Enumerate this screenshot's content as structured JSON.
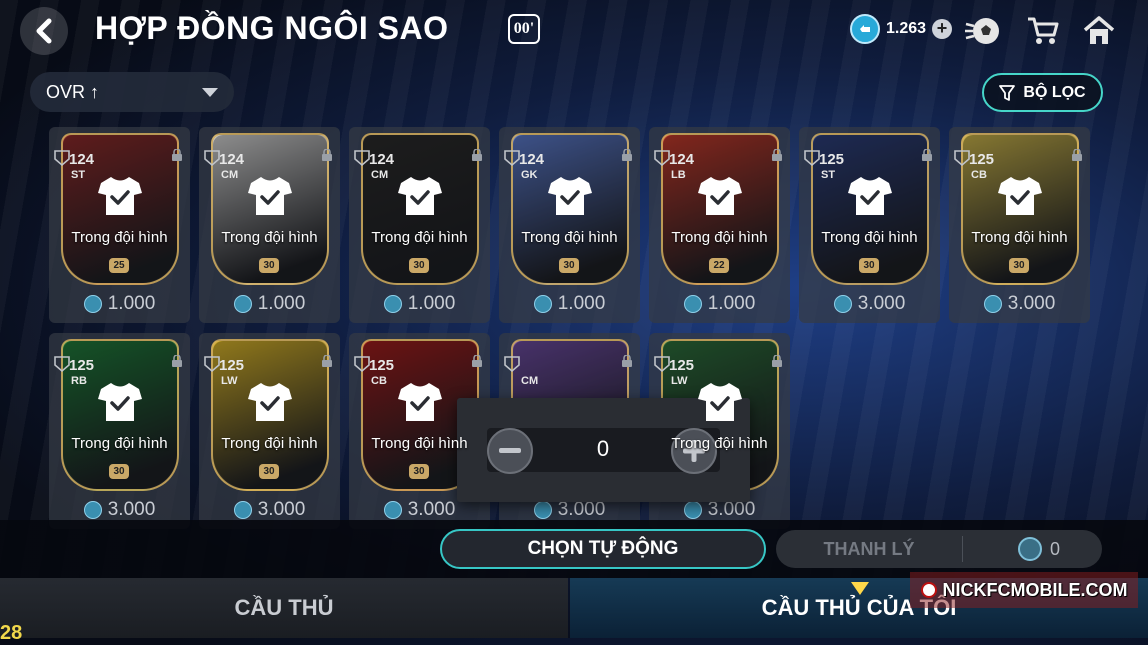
{
  "header": {
    "title": "HỢP ĐỒNG NGÔI SAO",
    "title_badge": "00'",
    "coins": "1.263"
  },
  "toolbar": {
    "sort_label": "OVR ↑",
    "filter_label": "BỘ LỌC"
  },
  "cards": [
    {
      "ovr": "124",
      "pos": "ST",
      "status": "Trong đội hình",
      "level": "25",
      "price": "1.000",
      "art": "#8b2a2a"
    },
    {
      "ovr": "124",
      "pos": "CM",
      "status": "Trong đội hình",
      "level": "30",
      "price": "1.000",
      "art": "#cfcfcf"
    },
    {
      "ovr": "124",
      "pos": "CM",
      "status": "Trong đội hình",
      "level": "30",
      "price": "1.000",
      "art": "#2b2b2b"
    },
    {
      "ovr": "124",
      "pos": "GK",
      "status": "Trong đội hình",
      "level": "30",
      "price": "1.000",
      "art": "#5a78c8"
    },
    {
      "ovr": "124",
      "pos": "LB",
      "status": "Trong đội hình",
      "level": "22",
      "price": "1.000",
      "art": "#c0392b"
    },
    {
      "ovr": "125",
      "pos": "ST",
      "status": "Trong đội hình",
      "level": "30",
      "price": "3.000",
      "art": "#2c3e7a"
    },
    {
      "ovr": "125",
      "pos": "CB",
      "status": "Trong đội hình",
      "level": "30",
      "price": "3.000",
      "art": "#c5b04a"
    },
    {
      "ovr": "125",
      "pos": "RB",
      "status": "Trong đội hình",
      "level": "30",
      "price": "3.000",
      "art": "#1f7a3a"
    },
    {
      "ovr": "125",
      "pos": "LW",
      "status": "Trong đội hình",
      "level": "30",
      "price": "3.000",
      "art": "#d4b12a"
    },
    {
      "ovr": "125",
      "pos": "CB",
      "status": "Trong đội hình",
      "level": "30",
      "price": "3.000",
      "art": "#9e1c1c"
    },
    {
      "ovr": "",
      "pos": "CM",
      "status": "",
      "level": "",
      "price": "3.000",
      "art": "#6a4a9c"
    },
    {
      "ovr": "125",
      "pos": "LW",
      "status": "Trong đội hình",
      "level": "",
      "price": "3.000",
      "art": "#2c6e3a"
    }
  ],
  "quantity": {
    "value": "0"
  },
  "actions": {
    "auto_select": "CHỌN TỰ ĐỘNG",
    "sell": "THANH LÝ",
    "sell_count": "0"
  },
  "tabs": {
    "players": "CẦU THỦ",
    "my_players": "CẦU THỦ CỦA TÔI"
  },
  "watermark": "NICKFCMOBILE.COM",
  "corner_number": "28",
  "colors": {
    "accent": "#37c7c6",
    "tab_indicator": "#ffd84a",
    "coin": "#27a9d8"
  }
}
